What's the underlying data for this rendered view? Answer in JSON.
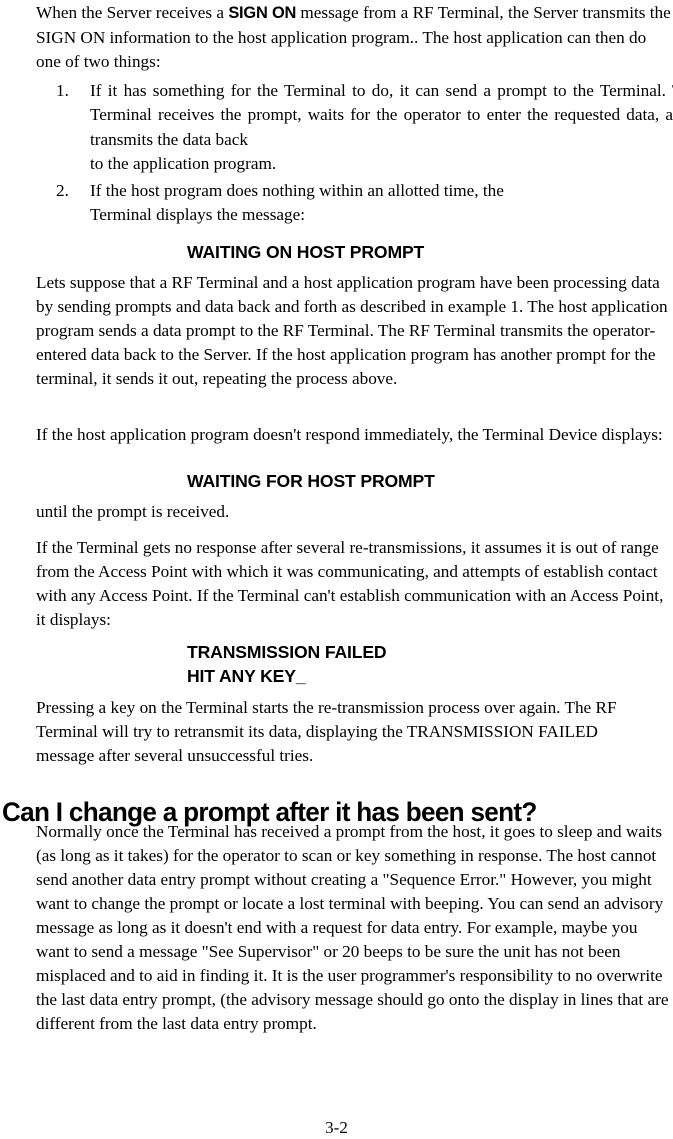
{
  "document": {
    "page_number": "3-2"
  },
  "intro": {
    "part1": "When the Server receives a ",
    "signon": "SIGN ON",
    "part2": " message from a RF Terminal, the Server transmits the SIGN ON information to the host application program.. The host application can then do one of two things:"
  },
  "list": {
    "items": [
      {
        "number": "1.",
        "text": "If it has something for the Terminal to do, it can send a prompt to the Terminal. The RF Terminal receives the prompt, waits for the operator to enter the requested data, and then transmits the data back ",
        "last_line": "to the application program."
      },
      {
        "number": "2.",
        "text": "If the host program does nothing within an allotted time, the ",
        "last_line": "Terminal displays the message:"
      }
    ]
  },
  "messages": {
    "waiting_on_host": "WAITING ON HOST PROMPT",
    "waiting_for_host": "WAITING FOR HOST PROMPT",
    "transmission_failed": "TRANSMISSION FAILED",
    "hit_any_key": "HIT ANY KEY_"
  },
  "paragraphs": {
    "example_flow": "Lets suppose that a RF Terminal and a host application program have been processing data by sending prompts and data back and forth as described in example 1.  The host application program sends a data prompt to the RF Terminal. The RF Terminal transmits the operator-entered data back to the Server.   If the host application program has another prompt for the terminal, it sends it out, repeating the process above.",
    "no_response": "If the host application program doesn't respond immediately, the Terminal Device displays:",
    "until_received": "until the prompt is received.",
    "out_of_range": "If the Terminal gets no response after several re-transmissions, it assumes it is out of range from the Access Point with which it was communicating, and attempts of establish contact with any Access Point.  If the Terminal can't establish communication with an Access Point, it displays:",
    "pressing_key": "Pressing a key on the Terminal starts the re-transmission process over again. The RF Terminal will try to retransmit its data, displaying the TRANSMISSION FAILED message after several unsuccessful tries.",
    "change_prompt_body": "Normally once the Terminal has received a prompt from the host, it goes to sleep and waits (as long as it takes) for the operator to scan or key something in response. The host cannot send another data entry prompt without creating a \"Sequence Error.\" However, you might want to change the prompt or locate a lost terminal with beeping. You can send an advisory message as long as it doesn't end with a request for data entry. For example, maybe you want to send a message \"See Supervisor\" or 20 beeps to be sure the unit has not been misplaced and to aid in finding it. It is the user programmer's responsibility to no overwrite the last data entry prompt, (the advisory message should go onto the display in lines that are different from the last data entry prompt."
  },
  "headings": {
    "can_i_change": "Can I change a prompt after it has been sent?"
  }
}
